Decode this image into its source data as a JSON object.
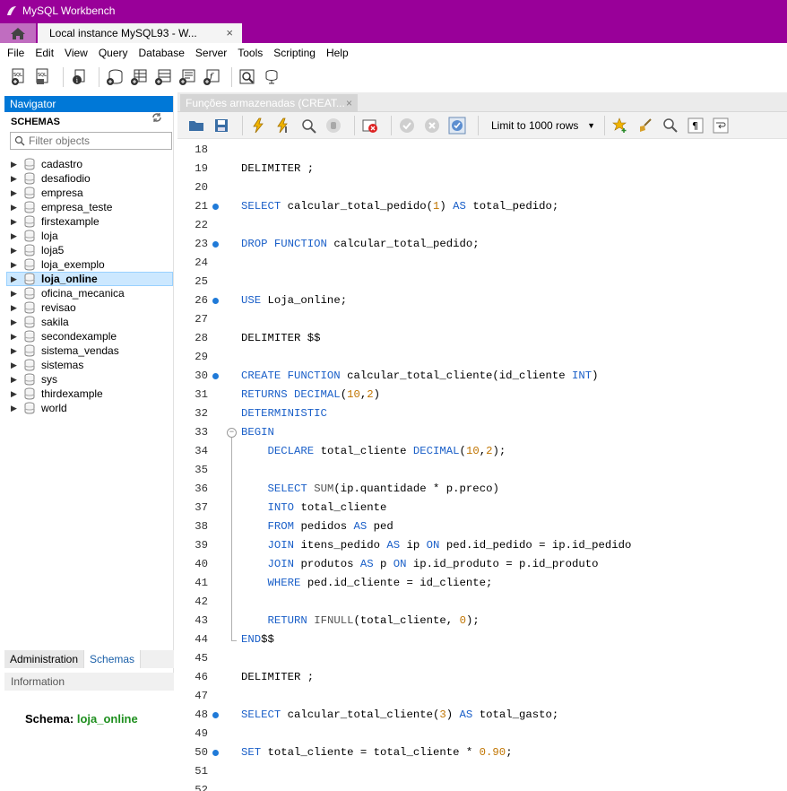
{
  "window": {
    "title": "MySQL Workbench",
    "connection_tab": "Local instance MySQL93 - W...",
    "connection_tab_close": "×"
  },
  "menu": [
    "File",
    "Edit",
    "View",
    "Query",
    "Database",
    "Server",
    "Tools",
    "Scripting",
    "Help"
  ],
  "navigator": {
    "header": "Navigator",
    "schemas_title": "SCHEMAS",
    "filter_placeholder": "Filter objects",
    "schemas": [
      "cadastro",
      "desafiodio",
      "empresa",
      "empresa_teste",
      "firstexample",
      "loja",
      "loja5",
      "loja_exemplo",
      "loja_online",
      "oficina_mecanica",
      "revisao",
      "sakila",
      "secondexample",
      "sistema_vendas",
      "sistemas",
      "sys",
      "thirdexample",
      "world"
    ],
    "selected_schema": "loja_online",
    "lower_tabs": [
      "Administration",
      "Schemas"
    ],
    "active_lower_tab": "Schemas",
    "information_header": "Information",
    "info_schema_label": "Schema:",
    "info_schema_value": "loja_online"
  },
  "editor": {
    "doc_tab": "Funções armazenadas (CREAT...",
    "doc_tab_close": "×",
    "limit_label": "Limit to 1000 rows",
    "lines": [
      {
        "n": "18",
        "tokens": []
      },
      {
        "n": "19",
        "tokens": [
          [
            "pl",
            "DELIMITER ;"
          ]
        ]
      },
      {
        "n": "20",
        "tokens": []
      },
      {
        "n": "21",
        "marker": true,
        "tokens": [
          [
            "kw",
            "SELECT"
          ],
          [
            "pl",
            " calcular_total_pedido("
          ],
          [
            "num",
            "1"
          ],
          [
            "pl",
            ") "
          ],
          [
            "kw",
            "AS"
          ],
          [
            "pl",
            " total_pedido;"
          ]
        ]
      },
      {
        "n": "22",
        "tokens": []
      },
      {
        "n": "23",
        "marker": true,
        "tokens": [
          [
            "kw",
            "DROP FUNCTION"
          ],
          [
            "pl",
            " calcular_total_pedido;"
          ]
        ]
      },
      {
        "n": "24",
        "tokens": []
      },
      {
        "n": "25",
        "tokens": []
      },
      {
        "n": "26",
        "marker": true,
        "tokens": [
          [
            "kw",
            "USE"
          ],
          [
            "pl",
            " Loja_online;"
          ]
        ]
      },
      {
        "n": "27",
        "tokens": []
      },
      {
        "n": "28",
        "tokens": [
          [
            "pl",
            "DELIMITER $$"
          ]
        ]
      },
      {
        "n": "29",
        "tokens": []
      },
      {
        "n": "30",
        "marker": true,
        "tokens": [
          [
            "kw",
            "CREATE FUNCTION"
          ],
          [
            "pl",
            " calcular_total_cliente(id_cliente "
          ],
          [
            "kw",
            "INT"
          ],
          [
            "pl",
            ")"
          ]
        ]
      },
      {
        "n": "31",
        "tokens": [
          [
            "kw",
            "RETURNS DECIMAL"
          ],
          [
            "pl",
            "("
          ],
          [
            "num",
            "10"
          ],
          [
            "pl",
            ","
          ],
          [
            "num",
            "2"
          ],
          [
            "pl",
            ")"
          ]
        ]
      },
      {
        "n": "32",
        "tokens": [
          [
            "kw",
            "DETERMINISTIC"
          ]
        ]
      },
      {
        "n": "33",
        "fold": true,
        "tokens": [
          [
            "kw",
            "BEGIN"
          ]
        ]
      },
      {
        "n": "34",
        "tokens": [
          [
            "pl",
            "    "
          ],
          [
            "kw",
            "DECLARE"
          ],
          [
            "pl",
            " total_cliente "
          ],
          [
            "kw",
            "DECIMAL"
          ],
          [
            "pl",
            "("
          ],
          [
            "num",
            "10"
          ],
          [
            "pl",
            ","
          ],
          [
            "num",
            "2"
          ],
          [
            "pl",
            ");"
          ]
        ]
      },
      {
        "n": "35",
        "tokens": []
      },
      {
        "n": "36",
        "tokens": [
          [
            "pl",
            "    "
          ],
          [
            "kw",
            "SELECT"
          ],
          [
            "pl",
            " "
          ],
          [
            "fn",
            "SUM"
          ],
          [
            "pl",
            "(ip.quantidade * p.preco)"
          ]
        ]
      },
      {
        "n": "37",
        "tokens": [
          [
            "pl",
            "    "
          ],
          [
            "kw",
            "INTO"
          ],
          [
            "pl",
            " total_cliente"
          ]
        ]
      },
      {
        "n": "38",
        "tokens": [
          [
            "pl",
            "    "
          ],
          [
            "kw",
            "FROM"
          ],
          [
            "pl",
            " pedidos "
          ],
          [
            "kw",
            "AS"
          ],
          [
            "pl",
            " ped"
          ]
        ]
      },
      {
        "n": "39",
        "tokens": [
          [
            "pl",
            "    "
          ],
          [
            "kw",
            "JOIN"
          ],
          [
            "pl",
            " itens_pedido "
          ],
          [
            "kw",
            "AS"
          ],
          [
            "pl",
            " ip "
          ],
          [
            "kw",
            "ON"
          ],
          [
            "pl",
            " ped.id_pedido = ip.id_pedido"
          ]
        ]
      },
      {
        "n": "40",
        "tokens": [
          [
            "pl",
            "    "
          ],
          [
            "kw",
            "JOIN"
          ],
          [
            "pl",
            " produtos "
          ],
          [
            "kw",
            "AS"
          ],
          [
            "pl",
            " p "
          ],
          [
            "kw",
            "ON"
          ],
          [
            "pl",
            " ip.id_produto = p.id_produto"
          ]
        ]
      },
      {
        "n": "41",
        "tokens": [
          [
            "pl",
            "    "
          ],
          [
            "kw",
            "WHERE"
          ],
          [
            "pl",
            " ped.id_cliente = id_cliente;"
          ]
        ]
      },
      {
        "n": "42",
        "tokens": []
      },
      {
        "n": "43",
        "tokens": [
          [
            "pl",
            "    "
          ],
          [
            "kw",
            "RETURN"
          ],
          [
            "pl",
            " "
          ],
          [
            "fn",
            "IFNULL"
          ],
          [
            "pl",
            "(total_cliente, "
          ],
          [
            "num",
            "0"
          ],
          [
            "pl",
            ");"
          ]
        ]
      },
      {
        "n": "44",
        "foldEnd": true,
        "tokens": [
          [
            "kw",
            "END"
          ],
          [
            "pl",
            "$$"
          ]
        ]
      },
      {
        "n": "45",
        "tokens": []
      },
      {
        "n": "46",
        "tokens": [
          [
            "pl",
            "DELIMITER ;"
          ]
        ]
      },
      {
        "n": "47",
        "tokens": []
      },
      {
        "n": "48",
        "marker": true,
        "tokens": [
          [
            "kw",
            "SELECT"
          ],
          [
            "pl",
            " calcular_total_cliente("
          ],
          [
            "num",
            "3"
          ],
          [
            "pl",
            ") "
          ],
          [
            "kw",
            "AS"
          ],
          [
            "pl",
            " total_gasto;"
          ]
        ]
      },
      {
        "n": "49",
        "tokens": []
      },
      {
        "n": "50",
        "marker": true,
        "tokens": [
          [
            "kw",
            "SET"
          ],
          [
            "pl",
            " total_cliente = total_cliente * "
          ],
          [
            "num",
            "0.90"
          ],
          [
            "pl",
            ";"
          ]
        ]
      },
      {
        "n": "51",
        "tokens": []
      },
      {
        "n": "52",
        "tokens": []
      }
    ]
  }
}
